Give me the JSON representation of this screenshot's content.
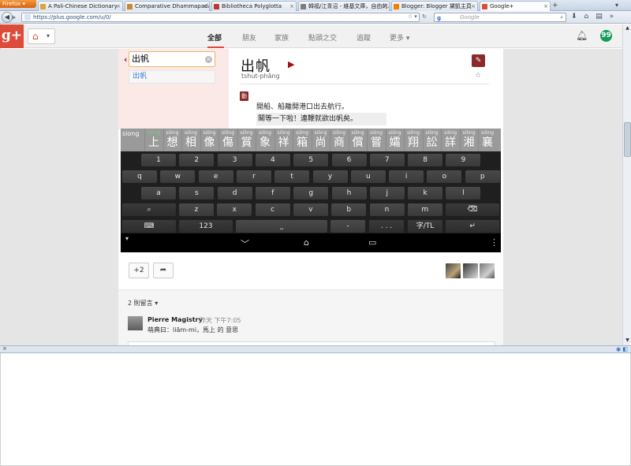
{
  "browser": {
    "app_button_label": "Firefox",
    "tabs": [
      {
        "title": "A Pali-Chinese Dictionary",
        "favicon_color": "#d9a441"
      },
      {
        "title": "Comparative Dhammapada - ...",
        "favicon_color": "#c98a2e"
      },
      {
        "title": "Bibliotheca Polyglotta",
        "favicon_color": "#b83a2c"
      },
      {
        "title": "韓福/江青沼 - 維基文庫，自由的...",
        "favicon_color": "#7c7c7c"
      },
      {
        "title": "Blogger: Blogger 黛凱主頁",
        "favicon_color": "#f57d00"
      },
      {
        "title": "Google+",
        "favicon_color": "#dd4b39"
      }
    ],
    "new_tab_icon": "+",
    "url": "https://plus.google.com/u/0/",
    "search_engine_label": "g",
    "search_placeholder": "Google"
  },
  "gplus_header": {
    "logo_text": "g+",
    "nav": [
      "全部",
      "朋友",
      "家族",
      "點頭之交",
      "追蹤",
      "更多"
    ],
    "active_nav_index": 0,
    "hangout_icon_text": "99"
  },
  "dictionary": {
    "search_value": "出帆",
    "suggestion": "出帆",
    "headword": "出帆",
    "romanization": "tshut-phâng",
    "part_of_speech": "動",
    "definition": "開船、船離開港口出去航行。",
    "example": "閣等一下啦！連鞭就欲出帆矣。"
  },
  "keyboard": {
    "first_candidate": "siong",
    "candidates": [
      {
        "py": "siōng",
        "hz": "上"
      },
      {
        "py": "siōng",
        "hz": "想"
      },
      {
        "py": "siōng",
        "hz": "相"
      },
      {
        "py": "siōng",
        "hz": "像"
      },
      {
        "py": "siōng",
        "hz": "傷"
      },
      {
        "py": "siōng",
        "hz": "賞"
      },
      {
        "py": "siōng",
        "hz": "象"
      },
      {
        "py": "siōng",
        "hz": "祥"
      },
      {
        "py": "siōng",
        "hz": "箱"
      },
      {
        "py": "siōng",
        "hz": "尚"
      },
      {
        "py": "siōng",
        "hz": "商"
      },
      {
        "py": "siōng",
        "hz": "償"
      },
      {
        "py": "siōng",
        "hz": "嘗"
      },
      {
        "py": "siōng",
        "hz": "孀"
      },
      {
        "py": "siōng",
        "hz": "翔"
      },
      {
        "py": "siōng",
        "hz": "訟"
      },
      {
        "py": "siōng",
        "hz": "詳"
      },
      {
        "py": "siōng",
        "hz": "湘"
      },
      {
        "py": "siōng",
        "hz": "襄"
      }
    ],
    "numbers": [
      "1",
      "2",
      "3",
      "4",
      "5",
      "6",
      "7",
      "8",
      "9"
    ],
    "row_qwerty": [
      "q",
      "w",
      "e",
      "r",
      "t",
      "y",
      "u",
      "i",
      "o",
      "p"
    ],
    "row_asdf": [
      "a",
      "s",
      "d",
      "f",
      "g",
      "h",
      "j",
      "k",
      "l"
    ],
    "row_zxcv": [
      "z",
      "x",
      "c",
      "v",
      "b",
      "n",
      "m"
    ],
    "del_label": "DEL",
    "mode_123": "123",
    "dash": "-",
    "dots": ". . .",
    "lang_toggle": "字/TL"
  },
  "post": {
    "plus_count": "+2"
  },
  "comments": {
    "count_label": "2 則留言",
    "author": "Pierre Magistry",
    "time": "昨天 下午7:05",
    "text": "萌典曰：liām-mi，馬上 的 意思"
  }
}
